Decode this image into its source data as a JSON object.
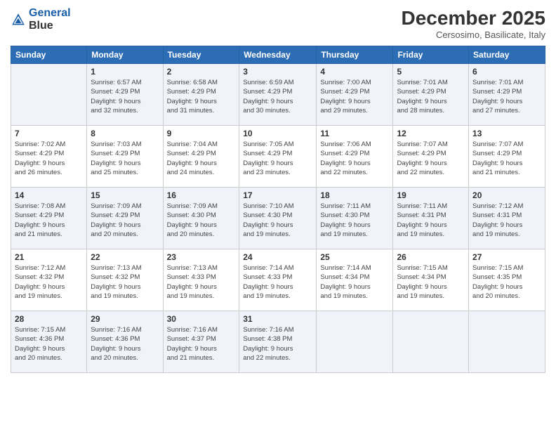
{
  "header": {
    "logo_line1": "General",
    "logo_line2": "Blue",
    "month": "December 2025",
    "location": "Cersosimo, Basilicate, Italy"
  },
  "days_of_week": [
    "Sunday",
    "Monday",
    "Tuesday",
    "Wednesday",
    "Thursday",
    "Friday",
    "Saturday"
  ],
  "weeks": [
    [
      {
        "day": "",
        "info": ""
      },
      {
        "day": "1",
        "info": "Sunrise: 6:57 AM\nSunset: 4:29 PM\nDaylight: 9 hours\nand 32 minutes."
      },
      {
        "day": "2",
        "info": "Sunrise: 6:58 AM\nSunset: 4:29 PM\nDaylight: 9 hours\nand 31 minutes."
      },
      {
        "day": "3",
        "info": "Sunrise: 6:59 AM\nSunset: 4:29 PM\nDaylight: 9 hours\nand 30 minutes."
      },
      {
        "day": "4",
        "info": "Sunrise: 7:00 AM\nSunset: 4:29 PM\nDaylight: 9 hours\nand 29 minutes."
      },
      {
        "day": "5",
        "info": "Sunrise: 7:01 AM\nSunset: 4:29 PM\nDaylight: 9 hours\nand 28 minutes."
      },
      {
        "day": "6",
        "info": "Sunrise: 7:01 AM\nSunset: 4:29 PM\nDaylight: 9 hours\nand 27 minutes."
      }
    ],
    [
      {
        "day": "7",
        "info": "Sunrise: 7:02 AM\nSunset: 4:29 PM\nDaylight: 9 hours\nand 26 minutes."
      },
      {
        "day": "8",
        "info": "Sunrise: 7:03 AM\nSunset: 4:29 PM\nDaylight: 9 hours\nand 25 minutes."
      },
      {
        "day": "9",
        "info": "Sunrise: 7:04 AM\nSunset: 4:29 PM\nDaylight: 9 hours\nand 24 minutes."
      },
      {
        "day": "10",
        "info": "Sunrise: 7:05 AM\nSunset: 4:29 PM\nDaylight: 9 hours\nand 23 minutes."
      },
      {
        "day": "11",
        "info": "Sunrise: 7:06 AM\nSunset: 4:29 PM\nDaylight: 9 hours\nand 22 minutes."
      },
      {
        "day": "12",
        "info": "Sunrise: 7:07 AM\nSunset: 4:29 PM\nDaylight: 9 hours\nand 22 minutes."
      },
      {
        "day": "13",
        "info": "Sunrise: 7:07 AM\nSunset: 4:29 PM\nDaylight: 9 hours\nand 21 minutes."
      }
    ],
    [
      {
        "day": "14",
        "info": "Sunrise: 7:08 AM\nSunset: 4:29 PM\nDaylight: 9 hours\nand 21 minutes."
      },
      {
        "day": "15",
        "info": "Sunrise: 7:09 AM\nSunset: 4:29 PM\nDaylight: 9 hours\nand 20 minutes."
      },
      {
        "day": "16",
        "info": "Sunrise: 7:09 AM\nSunset: 4:30 PM\nDaylight: 9 hours\nand 20 minutes."
      },
      {
        "day": "17",
        "info": "Sunrise: 7:10 AM\nSunset: 4:30 PM\nDaylight: 9 hours\nand 19 minutes."
      },
      {
        "day": "18",
        "info": "Sunrise: 7:11 AM\nSunset: 4:30 PM\nDaylight: 9 hours\nand 19 minutes."
      },
      {
        "day": "19",
        "info": "Sunrise: 7:11 AM\nSunset: 4:31 PM\nDaylight: 9 hours\nand 19 minutes."
      },
      {
        "day": "20",
        "info": "Sunrise: 7:12 AM\nSunset: 4:31 PM\nDaylight: 9 hours\nand 19 minutes."
      }
    ],
    [
      {
        "day": "21",
        "info": "Sunrise: 7:12 AM\nSunset: 4:32 PM\nDaylight: 9 hours\nand 19 minutes."
      },
      {
        "day": "22",
        "info": "Sunrise: 7:13 AM\nSunset: 4:32 PM\nDaylight: 9 hours\nand 19 minutes."
      },
      {
        "day": "23",
        "info": "Sunrise: 7:13 AM\nSunset: 4:33 PM\nDaylight: 9 hours\nand 19 minutes."
      },
      {
        "day": "24",
        "info": "Sunrise: 7:14 AM\nSunset: 4:33 PM\nDaylight: 9 hours\nand 19 minutes."
      },
      {
        "day": "25",
        "info": "Sunrise: 7:14 AM\nSunset: 4:34 PM\nDaylight: 9 hours\nand 19 minutes."
      },
      {
        "day": "26",
        "info": "Sunrise: 7:15 AM\nSunset: 4:34 PM\nDaylight: 9 hours\nand 19 minutes."
      },
      {
        "day": "27",
        "info": "Sunrise: 7:15 AM\nSunset: 4:35 PM\nDaylight: 9 hours\nand 20 minutes."
      }
    ],
    [
      {
        "day": "28",
        "info": "Sunrise: 7:15 AM\nSunset: 4:36 PM\nDaylight: 9 hours\nand 20 minutes."
      },
      {
        "day": "29",
        "info": "Sunrise: 7:16 AM\nSunset: 4:36 PM\nDaylight: 9 hours\nand 20 minutes."
      },
      {
        "day": "30",
        "info": "Sunrise: 7:16 AM\nSunset: 4:37 PM\nDaylight: 9 hours\nand 21 minutes."
      },
      {
        "day": "31",
        "info": "Sunrise: 7:16 AM\nSunset: 4:38 PM\nDaylight: 9 hours\nand 22 minutes."
      },
      {
        "day": "",
        "info": ""
      },
      {
        "day": "",
        "info": ""
      },
      {
        "day": "",
        "info": ""
      }
    ]
  ]
}
